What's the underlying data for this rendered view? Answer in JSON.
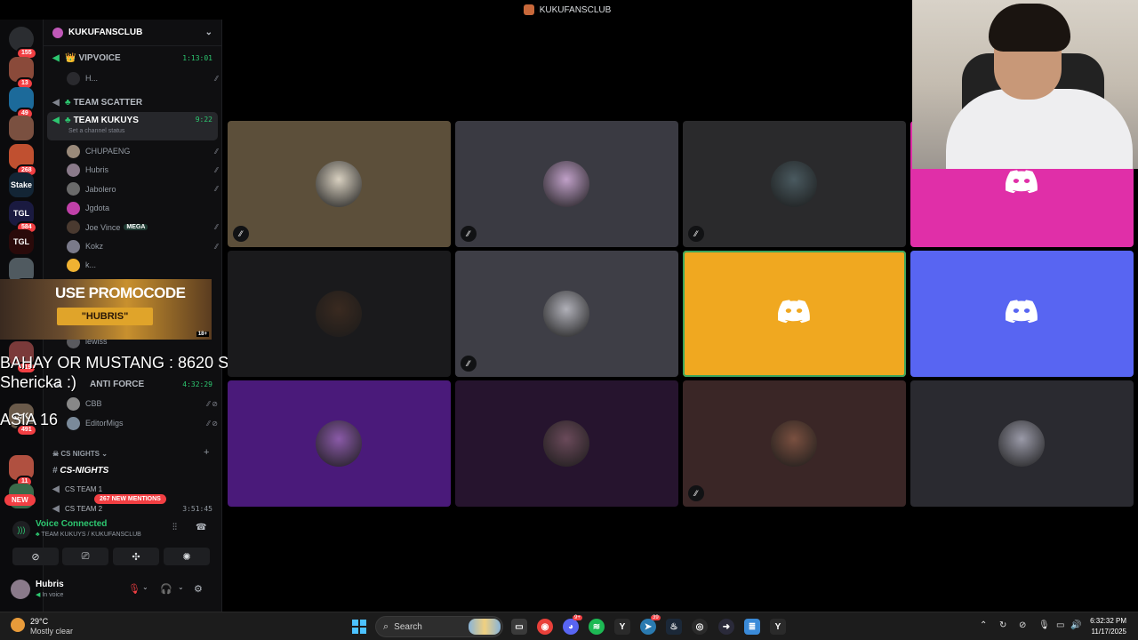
{
  "window": {
    "title": "KUKUFANSCLUB"
  },
  "rail": {
    "servers": [
      {
        "badge": "155",
        "color": "#2b2d31",
        "label": ""
      },
      {
        "badge": "13",
        "color": "#8a4a3a",
        "label": ""
      },
      {
        "badge": "49",
        "color": "#1c6a9a",
        "label": ""
      },
      {
        "badge": "",
        "color": "#7a5040",
        "label": ""
      },
      {
        "badge": "268",
        "color": "#c05030",
        "label": ""
      },
      {
        "badge": "",
        "color": "#132535",
        "label": "Stake"
      },
      {
        "badge": "584",
        "color": "#1a1a40",
        "label": "TGL"
      },
      {
        "badge": "",
        "color": "#2a0a0a",
        "label": "TGL"
      },
      {
        "badge": "289",
        "color": "#505a60",
        "label": ""
      },
      {
        "badge": "119",
        "color": "#7a3a3a",
        "label": ""
      },
      {
        "badge": "491",
        "color": "#6a5a4a",
        "label": "CrK"
      },
      {
        "badge": "11",
        "color": "#b05040",
        "label": ""
      },
      {
        "badge": "",
        "color": "#3a6a4a",
        "label": ""
      }
    ],
    "new_label": "NEW"
  },
  "sidebar": {
    "guild_name": "KUKUFANSCLUB",
    "channels": [
      {
        "name": "VIPVOICE",
        "time": "1:13:01",
        "prefix": "👑"
      },
      {
        "name": "TEAM SCATTER",
        "time": "",
        "prefix": "🍀"
      },
      {
        "name": "TEAM KUKUYS",
        "time": "9:22",
        "prefix": "🍀",
        "status": "Set a channel status"
      }
    ],
    "vip_member": "H...",
    "members": [
      {
        "name": "CHUPAENG",
        "color": "#9a8a7a"
      },
      {
        "name": "Hubris",
        "color": "#8a7a8a"
      },
      {
        "name": "Jabolero",
        "color": "#6a6a6a"
      },
      {
        "name": "Jgdota",
        "color": "#c040a8"
      },
      {
        "name": "Joe Vince",
        "color": "#4a3a30",
        "badge": "MEGA"
      },
      {
        "name": "Kokz",
        "color": "#7a7a8a"
      },
      {
        "name": "k...",
        "color": "#f0b232"
      }
    ],
    "hidden_member": "lewiss",
    "anti_force": {
      "name": "ANTI FORCE",
      "time": "4:32:29"
    },
    "anti_members": [
      {
        "name": "CBB",
        "color": "#888"
      },
      {
        "name": "EditorMigs",
        "color": "#7a8a9a"
      }
    ],
    "cs_section": "CS NIGHTS",
    "cs_text_channel": "CS-NIGHTS",
    "cs_team1": "CS TEAM 1",
    "cs_team2": "CS TEAM 2",
    "cs_team2_time": "3:51:45",
    "mentions": "267 NEW MENTIONS"
  },
  "promo": {
    "line1": "USE PROMOCODE",
    "line2": "\"HUBRIS\"",
    "age": "18+"
  },
  "overlay": {
    "line1": "BAHAY OR MUSTANG : 8620 SUBS",
    "line2": "Shericka :)",
    "line3": "ASIA 16"
  },
  "voice": {
    "status": "Voice Connected",
    "channel": "TEAM KUKUYS / KUKUFANSCLUB"
  },
  "user": {
    "name": "Hubris",
    "status": "In voice"
  },
  "tiles": [
    {
      "bg": "#5c4f3a",
      "avatar": "#d8d0c0",
      "muted": true,
      "discord": false
    },
    {
      "bg": "#3a3a42",
      "avatar": "#c0a0c8",
      "muted": true,
      "discord": false
    },
    {
      "bg": "#2a2a2c",
      "avatar": "#4a5a60",
      "muted": true,
      "discord": false
    },
    {
      "bg": "#e02fa8",
      "avatar": "",
      "muted": false,
      "discord": true
    },
    {
      "bg": "#1a1a1c",
      "avatar": "#3a2a20",
      "muted": false,
      "discord": false
    },
    {
      "bg": "#3e3e46",
      "avatar": "#b0b0b8",
      "muted": true,
      "discord": false
    },
    {
      "bg": "#f0a820",
      "avatar": "",
      "muted": false,
      "discord": true,
      "speaking": true
    },
    {
      "bg": "#5865f2",
      "avatar": "",
      "muted": false,
      "discord": true
    },
    {
      "bg": "#4a1a7a",
      "avatar": "#8a5aa8",
      "muted": false,
      "discord": false
    },
    {
      "bg": "#26142e",
      "avatar": "#6a4a5a",
      "muted": false,
      "discord": false
    },
    {
      "bg": "#3a2626",
      "avatar": "#7a5040",
      "muted": true,
      "discord": false
    },
    {
      "bg": "#2a2a30",
      "avatar": "#9a9aa8",
      "muted": false,
      "discord": false
    }
  ],
  "taskbar": {
    "temp": "29°C",
    "condition": "Mostly clear",
    "search": "Search",
    "time": "6:32:32 PM",
    "date": "11/17/2025",
    "discord_badge": "9+",
    "app_badge": "39"
  }
}
